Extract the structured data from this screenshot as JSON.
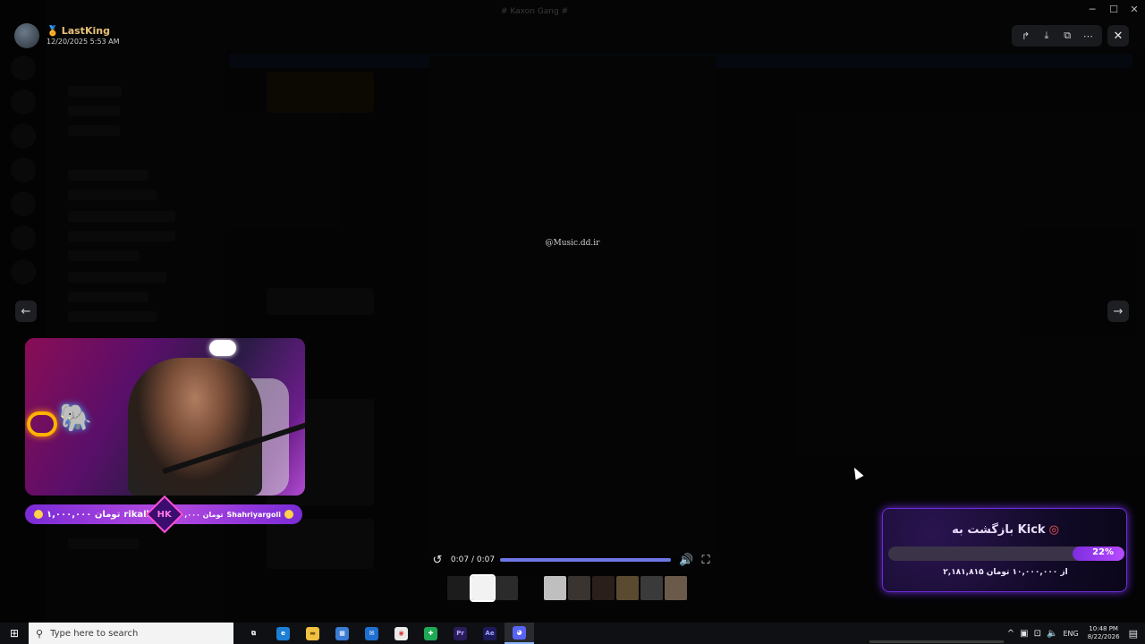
{
  "window": {
    "title": "# Kaxon Gang #"
  },
  "uploader": {
    "name": "LastKing",
    "date": "12/20/2025 5:53 AM"
  },
  "video": {
    "watermark": "@Music.dd.ir",
    "time": "0:07 / 0:07",
    "progress_fraction": 1.0
  },
  "thumbnails": [
    {
      "tone": "#1c1c1c"
    },
    {
      "tone": "#f2f2f2",
      "active": true
    },
    {
      "tone": "#2b2b2b"
    },
    {
      "tone": "#050505"
    },
    {
      "tone": "#bfbfbf"
    },
    {
      "tone": "#3a3430"
    },
    {
      "tone": "#2a1f1a"
    },
    {
      "tone": "#5a4a30"
    },
    {
      "tone": "#3a3a3a"
    },
    {
      "tone": "#6a5a4a"
    }
  ],
  "stream_overlay": {
    "donation_left_amount": "۱,۰۰۰,۰۰۰ تومان",
    "donation_left_name": "rikall",
    "donation_right_amount": "۲,۰۰۰,۰۰۰ تومان",
    "donation_right_name": "Shahriyargoli",
    "badge": "HK"
  },
  "goal": {
    "title": "بازگشت به Kick",
    "percent": "22%",
    "progress_fraction": 0.22,
    "subtitle": "۲,۱۸۱,۸۱۵ از ۱۰,۰۰۰,۰۰۰ تومان"
  },
  "taskbar": {
    "search_placeholder": "Type here to search",
    "language": "ENG",
    "time": "10:48 PM",
    "date": "8/22/2026",
    "apps": [
      {
        "name": "task-view",
        "label": "⧉",
        "bg": "transparent",
        "fg": "#fff"
      },
      {
        "name": "edge",
        "label": "e",
        "bg": "#1c7fd6",
        "fg": "#fff"
      },
      {
        "name": "file-explorer",
        "label": "▬",
        "bg": "#f0c040",
        "fg": "#7a5a10"
      },
      {
        "name": "store",
        "label": "▦",
        "bg": "#3a7bd5",
        "fg": "#fff"
      },
      {
        "name": "mail",
        "label": "✉",
        "bg": "#1f6fd0",
        "fg": "#fff"
      },
      {
        "name": "chrome",
        "label": "◉",
        "bg": "#e9e9e9",
        "fg": "#d33"
      },
      {
        "name": "app-green",
        "label": "✚",
        "bg": "#1fa856",
        "fg": "#fff"
      },
      {
        "name": "premiere",
        "label": "Pr",
        "bg": "#2a1b5a",
        "fg": "#b9a4ff"
      },
      {
        "name": "after-effects",
        "label": "Ae",
        "bg": "#1e1a5a",
        "fg": "#9fa6ff"
      },
      {
        "name": "discord",
        "label": "◕",
        "bg": "#5865f2",
        "fg": "#fff",
        "active": true
      }
    ]
  }
}
